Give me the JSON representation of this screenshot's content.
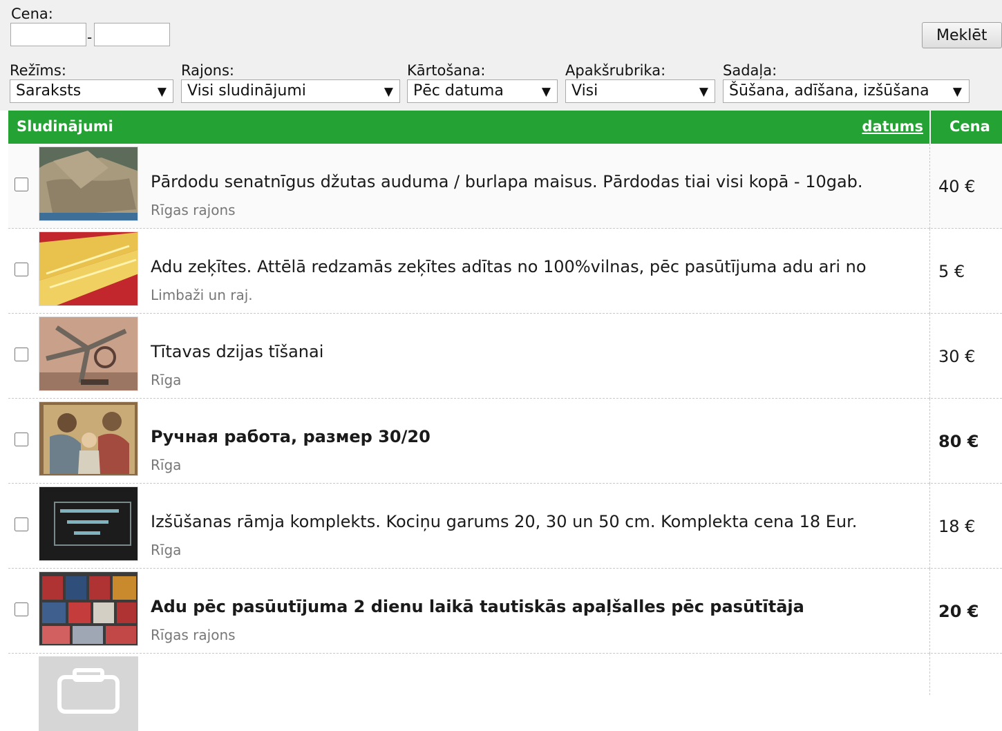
{
  "filters": {
    "price_label": "Cena:",
    "price_from_value": "",
    "price_separator": "-",
    "price_to_value": "",
    "search_button": "Meklēt",
    "mode": {
      "label": "Režīms:",
      "value": "Saraksts"
    },
    "region": {
      "label": "Rajons:",
      "value": "Visi sludinājumi"
    },
    "sort": {
      "label": "Kārtošana:",
      "value": "Pēc datuma"
    },
    "subcategory": {
      "label": "Apakšrubrika:",
      "value": "Visi"
    },
    "section": {
      "label": "Sadaļa:",
      "value": "Šūšana, adīšana, izšūšana"
    },
    "dropdown_arrow": "▼"
  },
  "table": {
    "header_title": "Sludinājumi",
    "header_date_link": "datums",
    "header_price": "Cena"
  },
  "listings": [
    {
      "title": "Pārdodu senatnīgus džutas auduma / burlapa maisus. Pārdodas tiai visi kopā - 10gab.",
      "location": "Rīgas rajons",
      "price": "40 €",
      "bold": false,
      "thumb_icon": "burlap-sacks-photo"
    },
    {
      "title": "Adu zeķītes. Attēlā redzamās zeķītes adītas no 100%vilnas, pēc pasūtījuma adu ari no",
      "location": "Limbaži un raj.",
      "price": "5 €",
      "bold": false,
      "thumb_icon": "knitted-socks-photo"
    },
    {
      "title": "Tītavas dzijas tīšanai",
      "location": "Rīga",
      "price": "30 €",
      "bold": false,
      "thumb_icon": "yarn-winder-photo"
    },
    {
      "title": "Ручная работа, размер 30/20",
      "location": "Rīga",
      "price": "80 €",
      "bold": true,
      "thumb_icon": "embroidered-icon-photo"
    },
    {
      "title": "Izšūšanas rāmja komplekts. Kociņu garums 20, 30 un 50 cm. Komplekta cena 18 Eur.",
      "location": "Rīga",
      "price": "18 €",
      "bold": false,
      "thumb_icon": "embroidery-frame-photo"
    },
    {
      "title": "Adu pēc pasūutījuma 2 dienu laikā tautiskās apaļšalles pēc pasūtītāja",
      "location": "Rīgas rajons",
      "price": "20 €",
      "bold": true,
      "thumb_icon": "knitted-scarves-photo"
    }
  ],
  "colors": {
    "header_green": "#24a234",
    "location_gray": "#777777"
  }
}
